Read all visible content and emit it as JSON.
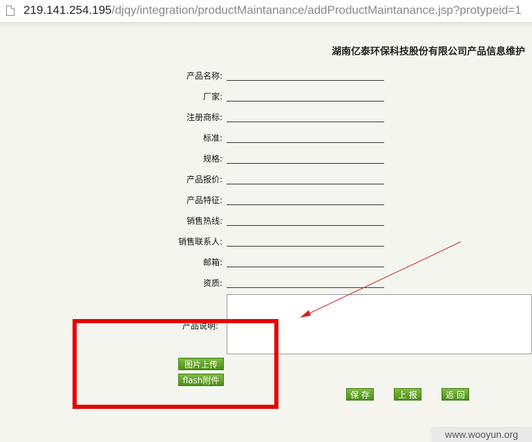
{
  "browser": {
    "url_host": "219.141.254.195",
    "url_path": "/djqy/integration/productMaintanance/addProductMaintanance.jsp?protypeid=1"
  },
  "page_title": "湖南亿泰环保科技股份有限公司产品信息维护",
  "fields": [
    {
      "label": "产品名称:"
    },
    {
      "label": "厂家:"
    },
    {
      "label": "注册商标:"
    },
    {
      "label": "标准:"
    },
    {
      "label": "规格:"
    },
    {
      "label": "产品报价:"
    },
    {
      "label": "产品特征:"
    },
    {
      "label": "销售热线:"
    },
    {
      "label": "销售联系人:"
    },
    {
      "label": "邮箱:"
    },
    {
      "label": "资质:"
    }
  ],
  "description_label": "产品说明:",
  "buttons": {
    "upload_image": "图片上传",
    "upload_flash": "flash附件",
    "save": "保 存",
    "report": "上 报",
    "back": "返 回"
  },
  "colors": {
    "button_green": "#5a9c1f",
    "highlight_red": "#e60000",
    "arrow_red": "#cc2222"
  },
  "watermark": "www.wooyun.org"
}
